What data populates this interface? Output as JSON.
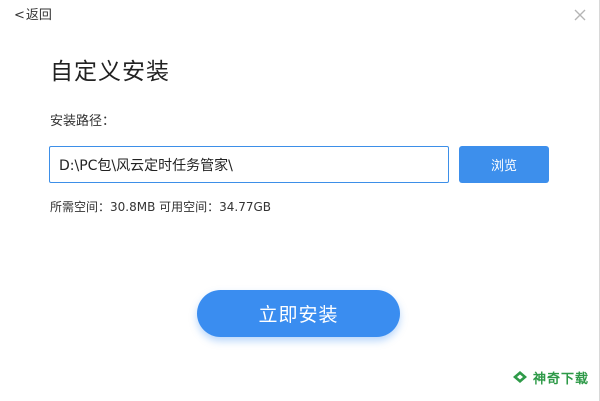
{
  "header": {
    "back_label": "返回",
    "back_chevron": "<"
  },
  "title": "自定义安装",
  "install_path": {
    "label": "安装路径：",
    "value": "D:\\PC包\\风云定时任务管家\\",
    "browse_label": "浏览"
  },
  "space_info": "所需空间：30.8MB  可用空间：34.77GB",
  "install_button": "立即安装",
  "watermark": {
    "text": "神奇下载",
    "color": "#2e9a48"
  },
  "colors": {
    "accent": "#3d8fec",
    "input_border": "#3d8fe8"
  },
  "icons": {
    "close": "close-icon",
    "watermark_logo": "leaf-logo-icon"
  }
}
